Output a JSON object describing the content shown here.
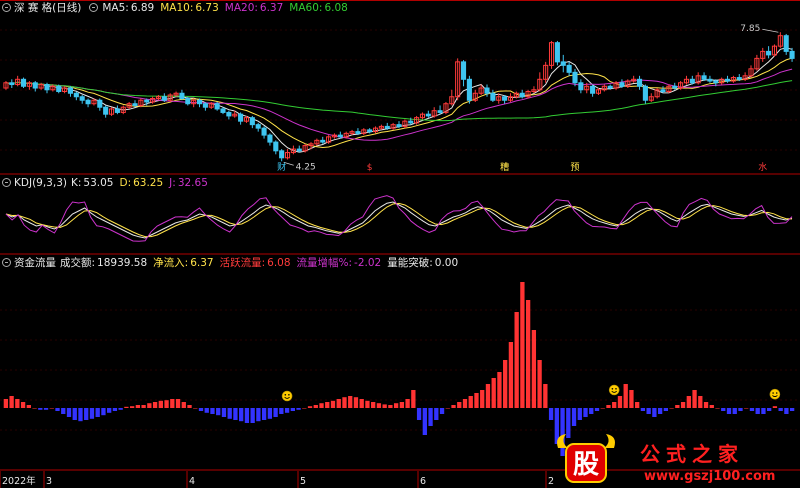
{
  "colors": {
    "up": "#ff3b3b",
    "down": "#3ec5f0",
    "ma5": "#e8e8e8",
    "ma10": "#ffe24a",
    "ma20": "#cc33cc",
    "ma60": "#33cc33",
    "k": "#e8e8e8",
    "d": "#ffe24a",
    "j": "#cc33cc",
    "bar_pos": "#ff3333",
    "bar_neg": "#3333ff",
    "frame": "#b00000",
    "grid": "#5a0000"
  },
  "main_panel": {
    "title": "深 赛 格(日线)",
    "collapse_icon": "circle-minus-icon",
    "indicators": [
      {
        "label": "MA5:",
        "value": "6.89",
        "color": "#e8e8e8"
      },
      {
        "label": "MA10:",
        "value": "6.73",
        "color": "#ffe24a"
      },
      {
        "label": "MA20:",
        "value": "6.37",
        "color": "#cc33cc"
      },
      {
        "label": "MA60:",
        "value": "6.08",
        "color": "#33cc33"
      }
    ],
    "high_label": "7.85",
    "low_label": "4.25",
    "event_marks": [
      {
        "text": "财",
        "color": "#3ec5f0"
      },
      {
        "text": "$",
        "color": "#ff3b3b"
      },
      {
        "text": "糟",
        "color": "#ffe24a"
      },
      {
        "text": "预",
        "color": "#ffe24a"
      },
      {
        "text": "水",
        "color": "#ff3b3b"
      }
    ]
  },
  "kdj_panel": {
    "title": "KDJ(9,3,3)",
    "indicators": [
      {
        "label": "K:",
        "value": "53.05",
        "color": "#e8e8e8"
      },
      {
        "label": "D:",
        "value": "63.25",
        "color": "#ffe24a"
      },
      {
        "label": "J:",
        "value": "32.65",
        "color": "#cc33cc"
      }
    ]
  },
  "fund_panel": {
    "title": "资金流量",
    "indicators": [
      {
        "label": "成交额:",
        "value": "18939.58",
        "color": "#e8e8e8"
      },
      {
        "label": "净流入:",
        "value": "6.37",
        "color": "#ffe24a"
      },
      {
        "label": "活跃流量:",
        "value": "6.08",
        "color": "#ff3b3b"
      },
      {
        "label": "流量增幅%:",
        "value": "-2.02",
        "color": "#cc33cc"
      },
      {
        "label": "量能突破:",
        "value": "0.00",
        "color": "#e8e8e8"
      }
    ]
  },
  "time_axis": {
    "labels": [
      "2022年",
      "3",
      "4",
      "5",
      "6",
      "2"
    ]
  },
  "watermark": {
    "logo_char": "股",
    "brand": "公式之家",
    "url": "www.gszj100.com"
  },
  "chart_data": {
    "type": "candlestick",
    "price_range": [
      4.0,
      8.3
    ],
    "candles": [
      [
        6.35,
        6.5,
        6.3,
        6.55
      ],
      [
        6.5,
        6.45,
        6.35,
        6.6
      ],
      [
        6.45,
        6.6,
        6.4,
        6.7
      ],
      [
        6.6,
        6.4,
        6.35,
        6.65
      ],
      [
        6.4,
        6.5,
        6.3,
        6.55
      ],
      [
        6.5,
        6.35,
        6.25,
        6.55
      ],
      [
        6.35,
        6.45,
        6.3,
        6.5
      ],
      [
        6.45,
        6.3,
        6.2,
        6.5
      ],
      [
        6.3,
        6.4,
        6.25,
        6.45
      ],
      [
        6.4,
        6.25,
        6.2,
        6.45
      ],
      [
        6.25,
        6.35,
        6.2,
        6.4
      ],
      [
        6.35,
        6.2,
        6.1,
        6.4
      ],
      [
        6.2,
        6.1,
        6.0,
        6.25
      ],
      [
        6.1,
        6.0,
        5.9,
        6.15
      ],
      [
        6.0,
        5.9,
        5.8,
        6.05
      ],
      [
        5.9,
        6.0,
        5.85,
        6.05
      ],
      [
        6.0,
        5.8,
        5.7,
        6.05
      ],
      [
        5.8,
        5.6,
        5.5,
        5.85
      ],
      [
        5.6,
        5.75,
        5.55,
        5.8
      ],
      [
        5.75,
        5.65,
        5.6,
        5.85
      ],
      [
        5.65,
        5.8,
        5.6,
        5.85
      ],
      [
        5.8,
        5.9,
        5.75,
        5.95
      ],
      [
        5.9,
        5.85,
        5.8,
        6.0
      ],
      [
        5.85,
        6.0,
        5.8,
        6.05
      ],
      [
        6.0,
        5.95,
        5.85,
        6.05
      ],
      [
        5.95,
        6.05,
        5.9,
        6.1
      ],
      [
        6.05,
        6.1,
        6.0,
        6.15
      ],
      [
        6.1,
        6.0,
        5.95,
        6.2
      ],
      [
        6.0,
        6.15,
        5.95,
        6.2
      ],
      [
        6.15,
        6.2,
        6.1,
        6.25
      ],
      [
        6.2,
        6.05,
        6.0,
        6.3
      ],
      [
        6.05,
        5.9,
        5.85,
        6.1
      ],
      [
        5.9,
        6.0,
        5.8,
        6.05
      ],
      [
        6.0,
        5.9,
        5.8,
        6.05
      ],
      [
        5.9,
        5.8,
        5.7,
        5.95
      ],
      [
        5.8,
        5.9,
        5.75,
        5.95
      ],
      [
        5.9,
        5.75,
        5.7,
        5.95
      ],
      [
        5.75,
        5.65,
        5.6,
        5.8
      ],
      [
        5.65,
        5.55,
        5.45,
        5.7
      ],
      [
        5.55,
        5.6,
        5.5,
        5.7
      ],
      [
        5.6,
        5.4,
        5.3,
        5.65
      ],
      [
        5.4,
        5.5,
        5.35,
        5.55
      ],
      [
        5.5,
        5.3,
        5.2,
        5.55
      ],
      [
        5.3,
        5.2,
        5.1,
        5.35
      ],
      [
        5.2,
        5.0,
        4.9,
        5.25
      ],
      [
        5.0,
        4.8,
        4.7,
        5.05
      ],
      [
        4.8,
        4.55,
        4.45,
        4.85
      ],
      [
        4.55,
        4.35,
        4.25,
        4.6
      ],
      [
        4.35,
        4.5,
        4.3,
        4.6
      ],
      [
        4.5,
        4.6,
        4.45,
        4.7
      ],
      [
        4.6,
        4.55,
        4.5,
        4.7
      ],
      [
        4.55,
        4.7,
        4.5,
        4.75
      ],
      [
        4.7,
        4.75,
        4.6,
        4.8
      ],
      [
        4.75,
        4.85,
        4.7,
        4.9
      ],
      [
        4.85,
        4.8,
        4.75,
        4.95
      ],
      [
        4.8,
        4.95,
        4.75,
        5.0
      ],
      [
        4.95,
        5.0,
        4.9,
        5.05
      ],
      [
        5.0,
        4.95,
        4.9,
        5.1
      ],
      [
        4.95,
        5.05,
        4.9,
        5.1
      ],
      [
        5.05,
        5.1,
        5.0,
        5.15
      ],
      [
        5.1,
        5.05,
        5.0,
        5.2
      ],
      [
        5.05,
        5.15,
        5.0,
        5.2
      ],
      [
        5.15,
        5.1,
        5.05,
        5.2
      ],
      [
        5.1,
        5.2,
        5.05,
        5.25
      ],
      [
        5.2,
        5.25,
        5.15,
        5.3
      ],
      [
        5.25,
        5.2,
        5.15,
        5.35
      ],
      [
        5.2,
        5.3,
        5.15,
        5.35
      ],
      [
        5.3,
        5.25,
        5.2,
        5.4
      ],
      [
        5.25,
        5.4,
        5.2,
        5.45
      ],
      [
        5.4,
        5.35,
        5.3,
        5.5
      ],
      [
        5.35,
        5.5,
        5.3,
        5.55
      ],
      [
        5.5,
        5.6,
        5.45,
        5.65
      ],
      [
        5.6,
        5.55,
        5.5,
        5.7
      ],
      [
        5.55,
        5.7,
        5.5,
        5.8
      ],
      [
        5.7,
        5.65,
        5.6,
        5.85
      ],
      [
        5.65,
        5.9,
        5.6,
        5.95
      ],
      [
        5.9,
        6.1,
        5.85,
        6.3
      ],
      [
        6.1,
        7.1,
        6.0,
        7.2
      ],
      [
        7.1,
        6.6,
        6.4,
        7.15
      ],
      [
        6.6,
        6.0,
        5.9,
        6.7
      ],
      [
        6.0,
        6.2,
        5.95,
        6.3
      ],
      [
        6.2,
        6.35,
        6.15,
        6.45
      ],
      [
        6.35,
        6.2,
        6.1,
        6.45
      ],
      [
        6.2,
        6.0,
        5.95,
        6.3
      ],
      [
        6.0,
        6.1,
        5.9,
        6.2
      ],
      [
        6.1,
        6.0,
        5.9,
        6.15
      ],
      [
        6.0,
        6.1,
        5.95,
        6.2
      ],
      [
        6.1,
        6.2,
        6.05,
        6.25
      ],
      [
        6.2,
        6.1,
        6.05,
        6.3
      ],
      [
        6.1,
        6.25,
        6.05,
        6.3
      ],
      [
        6.25,
        6.3,
        6.2,
        6.4
      ],
      [
        6.3,
        6.6,
        6.25,
        6.8
      ],
      [
        6.6,
        7.0,
        6.5,
        7.1
      ],
      [
        7.0,
        7.65,
        6.9,
        7.7
      ],
      [
        7.65,
        7.1,
        7.0,
        7.7
      ],
      [
        7.1,
        7.0,
        6.8,
        7.3
      ],
      [
        7.0,
        6.8,
        6.7,
        7.1
      ],
      [
        6.8,
        6.5,
        6.4,
        6.9
      ],
      [
        6.5,
        6.3,
        6.2,
        6.6
      ],
      [
        6.3,
        6.4,
        6.2,
        6.5
      ],
      [
        6.4,
        6.2,
        6.1,
        6.45
      ],
      [
        6.2,
        6.3,
        6.15,
        6.35
      ],
      [
        6.3,
        6.4,
        6.25,
        6.45
      ],
      [
        6.4,
        6.35,
        6.3,
        6.45
      ],
      [
        6.35,
        6.5,
        6.3,
        6.55
      ],
      [
        6.5,
        6.4,
        6.35,
        6.6
      ],
      [
        6.4,
        6.55,
        6.35,
        6.6
      ],
      [
        6.55,
        6.6,
        6.5,
        6.7
      ],
      [
        6.6,
        6.4,
        6.3,
        6.7
      ],
      [
        6.4,
        6.0,
        5.9,
        6.45
      ],
      [
        6.0,
        6.1,
        5.95,
        6.2
      ],
      [
        6.1,
        6.3,
        6.05,
        6.35
      ],
      [
        6.3,
        6.25,
        6.2,
        6.4
      ],
      [
        6.25,
        6.4,
        6.2,
        6.45
      ],
      [
        6.4,
        6.35,
        6.3,
        6.5
      ],
      [
        6.35,
        6.5,
        6.3,
        6.55
      ],
      [
        6.5,
        6.6,
        6.45,
        6.7
      ],
      [
        6.6,
        6.5,
        6.45,
        6.7
      ],
      [
        6.5,
        6.7,
        6.45,
        6.8
      ],
      [
        6.7,
        6.6,
        6.55,
        6.8
      ],
      [
        6.6,
        6.55,
        6.5,
        6.7
      ],
      [
        6.55,
        6.5,
        6.4,
        6.6
      ],
      [
        6.5,
        6.6,
        6.45,
        6.65
      ],
      [
        6.6,
        6.55,
        6.5,
        6.7
      ],
      [
        6.55,
        6.65,
        6.5,
        6.7
      ],
      [
        6.65,
        6.6,
        6.55,
        6.75
      ],
      [
        6.6,
        6.7,
        6.55,
        6.8
      ],
      [
        6.7,
        6.9,
        6.65,
        7.0
      ],
      [
        6.9,
        7.2,
        6.85,
        7.3
      ],
      [
        7.2,
        7.4,
        7.1,
        7.5
      ],
      [
        7.4,
        7.3,
        7.2,
        7.55
      ],
      [
        7.3,
        7.55,
        7.25,
        7.6
      ],
      [
        7.55,
        7.85,
        7.5,
        7.95
      ],
      [
        7.85,
        7.4,
        7.3,
        7.9
      ],
      [
        7.4,
        7.2,
        7.1,
        7.5
      ]
    ],
    "kdj": {
      "k": [
        60,
        55,
        58,
        50,
        45,
        40,
        42,
        38,
        35,
        40,
        50,
        60,
        65,
        70,
        62,
        55,
        50,
        45,
        40,
        35,
        30,
        25,
        22,
        20,
        25,
        30,
        35,
        40,
        45,
        48,
        50,
        55,
        60,
        58,
        55,
        50,
        45,
        40,
        42,
        48,
        55,
        62,
        70,
        75,
        72,
        68,
        62,
        55,
        50,
        45,
        40,
        38,
        35,
        32,
        30,
        28,
        30,
        35,
        40,
        45,
        55,
        65,
        72,
        78,
        80,
        75,
        70,
        62,
        55,
        48,
        42,
        40,
        45,
        50,
        55,
        58,
        62,
        68,
        72,
        70,
        65,
        58,
        50,
        45,
        40,
        38,
        36,
        40,
        46,
        52,
        60,
        68,
        72,
        75,
        70,
        65,
        58,
        52,
        48,
        45,
        42,
        40,
        45,
        52,
        60,
        66,
        70,
        68,
        64,
        58,
        52,
        48,
        55,
        62,
        68,
        74,
        76,
        72,
        68,
        64,
        60,
        58,
        56,
        58,
        62,
        66,
        60,
        55,
        52,
        50,
        53
      ]
    },
    "fund_flow": [
      1.5,
      2,
      1.5,
      1,
      0.5,
      0,
      -0.3,
      -0.3,
      0,
      -0.5,
      -1,
      -1.5,
      -2,
      -2.2,
      -2,
      -1.8,
      -1.5,
      -1.2,
      -0.8,
      -0.5,
      -0.3,
      0.2,
      0.3,
      0.5,
      0.5,
      0.8,
      1,
      1.2,
      1.3,
      1.5,
      1.5,
      1,
      0.5,
      0,
      -0.5,
      -0.8,
      -1,
      -1.2,
      -1.5,
      -1.8,
      -2,
      -2.2,
      -2.5,
      -2.5,
      -2.2,
      -2,
      -1.8,
      -1.5,
      -1,
      -0.8,
      -0.5,
      -0.3,
      0,
      0.3,
      0.5,
      0.8,
      1,
      1.2,
      1.5,
      1.8,
      2,
      1.8,
      1.5,
      1.2,
      1,
      0.8,
      0.6,
      0.5,
      0.8,
      1,
      1.5,
      3,
      -2,
      -4.5,
      -3,
      -2,
      -1,
      0,
      0.5,
      1,
      1.5,
      2,
      2.5,
      3,
      4,
      5,
      6,
      8,
      11,
      16,
      21,
      18,
      13,
      8,
      4,
      -2,
      -6,
      -8,
      -5,
      -3,
      -2,
      -1.5,
      -1,
      -0.5,
      0,
      0.5,
      1,
      2,
      4,
      3,
      1,
      -0.5,
      -1,
      -1.5,
      -1,
      -0.5,
      0,
      0.5,
      1,
      2,
      3,
      2,
      1,
      0.5,
      0,
      -0.5,
      -1,
      -1,
      -0.5,
      0,
      -0.5,
      -1,
      -1,
      -0.5,
      0.3,
      -0.5,
      -1,
      -0.5
    ],
    "smiley_indices": [
      48,
      104,
      131,
      195
    ]
  }
}
